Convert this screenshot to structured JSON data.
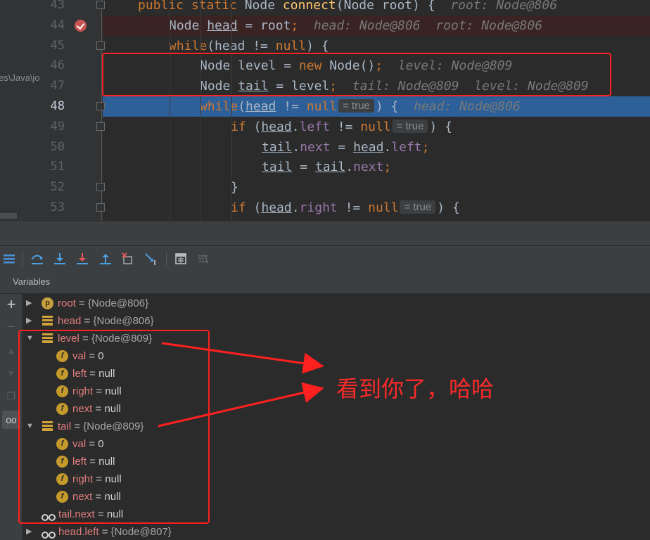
{
  "editor": {
    "side_path": "es\\Java\\jo",
    "lines": [
      {
        "num": "43",
        "segments": [
          [
            "kw",
            "public static "
          ],
          [
            "plain",
            "Node "
          ],
          [
            "fn",
            "connect"
          ],
          [
            "plain",
            "(Node root) {  "
          ],
          [
            "hint",
            "root: Node@806"
          ]
        ]
      },
      {
        "num": "44",
        "segments": [
          [
            "plain",
            "Node "
          ],
          [
            "ul",
            "head"
          ],
          [
            "plain",
            " = root"
          ],
          [
            "kw",
            ";"
          ],
          [
            "hint",
            "  head: Node@806  root: Node@806"
          ]
        ]
      },
      {
        "num": "45",
        "segments": [
          [
            "kw",
            "while"
          ],
          [
            "plain",
            "("
          ],
          [
            "plain",
            "head != "
          ],
          [
            "kw",
            "null"
          ],
          [
            "plain",
            ") {"
          ]
        ]
      },
      {
        "num": "46",
        "segments": [
          [
            "plain",
            "Node level = "
          ],
          [
            "kw",
            "new "
          ],
          [
            "plain",
            "Node()"
          ],
          [
            "kw",
            ";"
          ],
          [
            "hint",
            "  level: Node@809"
          ]
        ]
      },
      {
        "num": "47",
        "segments": [
          [
            "plain",
            "Node "
          ],
          [
            "ul",
            "tail"
          ],
          [
            "plain",
            " = level"
          ],
          [
            "kw",
            ";"
          ],
          [
            "hint",
            "  tail: Node@809  level: Node@809"
          ]
        ]
      },
      {
        "num": "48",
        "segments": [
          [
            "kw",
            "while"
          ],
          [
            "plain",
            "("
          ],
          [
            "ul",
            "head"
          ],
          [
            "plain",
            " != "
          ],
          [
            "kw",
            "null"
          ],
          [
            "inline",
            "= true"
          ],
          [
            "plain",
            ") {  "
          ],
          [
            "hint",
            "head: Node@806"
          ]
        ]
      },
      {
        "num": "49",
        "segments": [
          [
            "kw",
            "if "
          ],
          [
            "plain",
            "("
          ],
          [
            "ul",
            "head"
          ],
          [
            "plain",
            "."
          ],
          [
            "fld",
            "left"
          ],
          [
            "plain",
            " != "
          ],
          [
            "kw",
            "null"
          ],
          [
            "inline",
            "= true"
          ],
          [
            "plain",
            ") {"
          ]
        ]
      },
      {
        "num": "50",
        "segments": [
          [
            "ul",
            "tail"
          ],
          [
            "plain",
            "."
          ],
          [
            "fld",
            "next"
          ],
          [
            "plain",
            " = "
          ],
          [
            "ul",
            "head"
          ],
          [
            "plain",
            "."
          ],
          [
            "fld",
            "left"
          ],
          [
            "kw",
            ";"
          ]
        ]
      },
      {
        "num": "51",
        "segments": [
          [
            "ul",
            "tail"
          ],
          [
            "plain",
            " = "
          ],
          [
            "ul",
            "tail"
          ],
          [
            "plain",
            "."
          ],
          [
            "fld",
            "next"
          ],
          [
            "kw",
            ";"
          ]
        ]
      },
      {
        "num": "52",
        "segments": [
          [
            "plain",
            "}"
          ]
        ]
      },
      {
        "num": "53",
        "segments": [
          [
            "kw",
            "if "
          ],
          [
            "plain",
            "("
          ],
          [
            "ul",
            "head"
          ],
          [
            "plain",
            "."
          ],
          [
            "fld",
            "right"
          ],
          [
            "plain",
            " != "
          ],
          [
            "kw",
            "null"
          ],
          [
            "inline",
            "= true"
          ],
          [
            "plain",
            ") {"
          ]
        ]
      }
    ]
  },
  "panel": {
    "title": "Variables"
  },
  "variables": [
    {
      "icon": "p",
      "name": "root",
      "value": "{Node@806}",
      "expanded": false
    },
    {
      "icon": "stack",
      "name": "head",
      "value": "{Node@806}",
      "expanded": false
    },
    {
      "icon": "stack",
      "name": "level",
      "value": "{Node@809}",
      "expanded": true
    },
    {
      "icon": "f",
      "name": "val",
      "value": "0",
      "child": true
    },
    {
      "icon": "f",
      "name": "left",
      "value": "null",
      "child": true
    },
    {
      "icon": "f",
      "name": "right",
      "value": "null",
      "child": true
    },
    {
      "icon": "f",
      "name": "next",
      "value": "null",
      "child": true
    },
    {
      "icon": "stack",
      "name": "tail",
      "value": "{Node@809}",
      "expanded": true
    },
    {
      "icon": "f",
      "name": "val",
      "value": "0",
      "child": true
    },
    {
      "icon": "f",
      "name": "left",
      "value": "null",
      "child": true
    },
    {
      "icon": "f",
      "name": "right",
      "value": "null",
      "child": true
    },
    {
      "icon": "f",
      "name": "next",
      "value": "null",
      "child": true
    },
    {
      "icon": "oo",
      "name": "tail.next",
      "value": "null",
      "watch": true
    },
    {
      "icon": "oo",
      "name": "head.left",
      "value": "{Node@807}",
      "expanded": false
    }
  ],
  "annotation": {
    "text": "看到你了，哈哈",
    "color": "#ff2020"
  },
  "colors": {
    "keyword": "#cc7832",
    "method": "#ffc66d",
    "field": "#9876aa",
    "current_line": "#2d6099",
    "breakpoint": "#c75450",
    "var_name": "#e07d7d"
  }
}
